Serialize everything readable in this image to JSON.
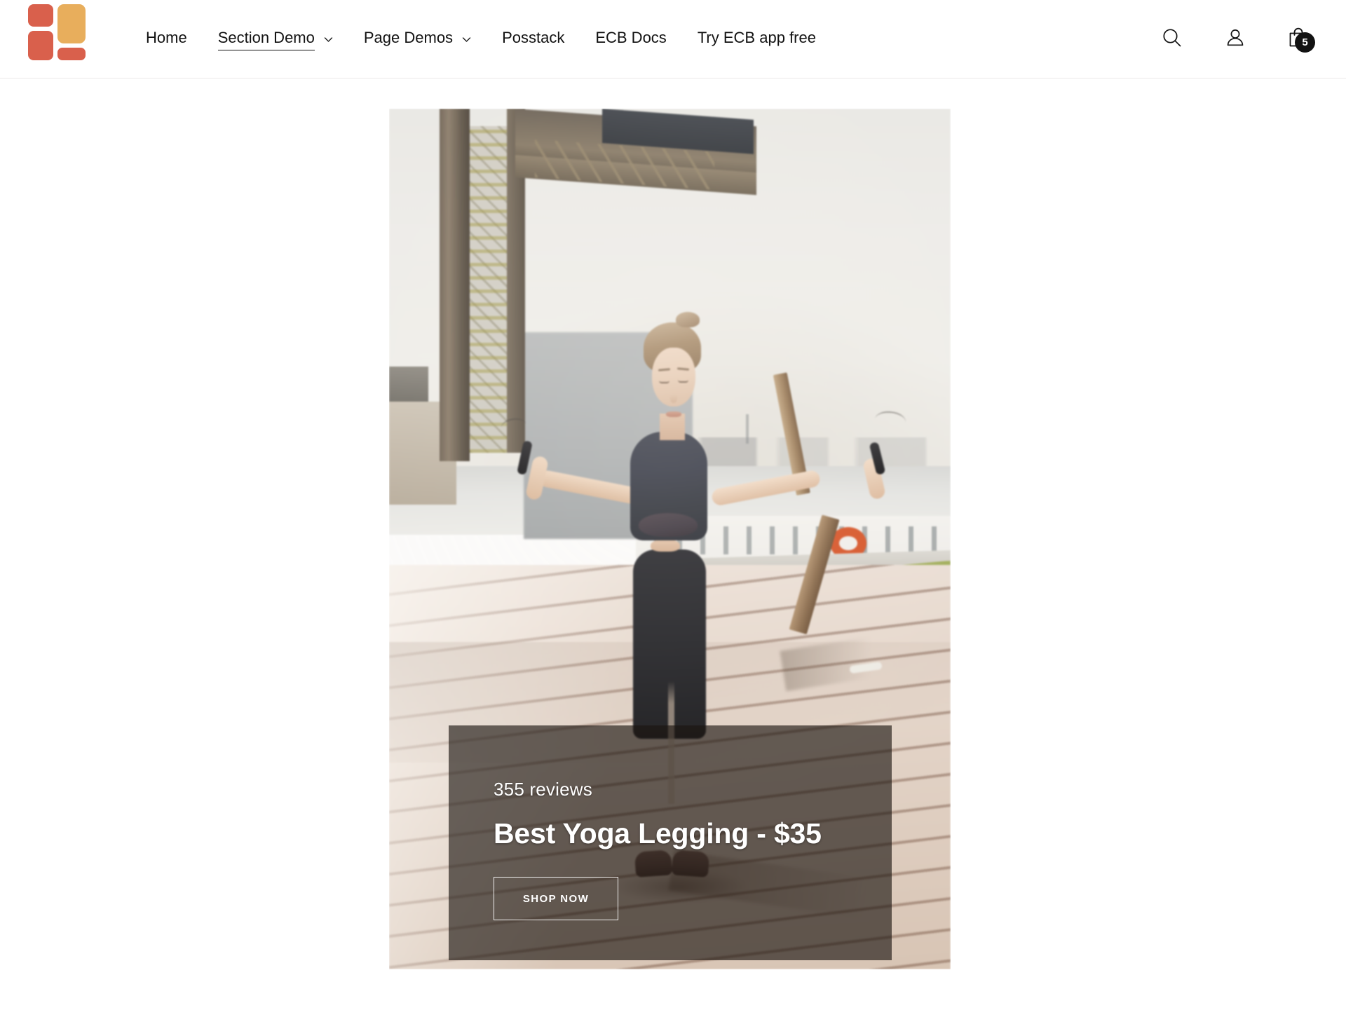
{
  "header": {
    "logo": {
      "name": "brand-logo",
      "colors": {
        "red": "#d9604c",
        "orange": "#e8ae5c"
      }
    },
    "nav": [
      {
        "label": "Home",
        "active": false,
        "has_dropdown": false
      },
      {
        "label": "Section Demo",
        "active": true,
        "has_dropdown": true
      },
      {
        "label": "Page Demos",
        "active": false,
        "has_dropdown": true
      },
      {
        "label": "Posstack",
        "active": false,
        "has_dropdown": false
      },
      {
        "label": "ECB Docs",
        "active": false,
        "has_dropdown": false
      },
      {
        "label": "Try ECB app free",
        "active": false,
        "has_dropdown": false
      }
    ],
    "actions": {
      "search_icon": "search-icon",
      "account_icon": "account-icon",
      "cart_icon": "shopping-bag-icon",
      "cart_count": "5"
    }
  },
  "hero": {
    "image_alt": "Woman jumping rope on a waterfront boardwalk",
    "overlay": {
      "reviews": "355 reviews",
      "headline": "Best Yoga Legging - $35",
      "cta_label": "SHOP NOW",
      "background_color": "#1a1410"
    }
  }
}
